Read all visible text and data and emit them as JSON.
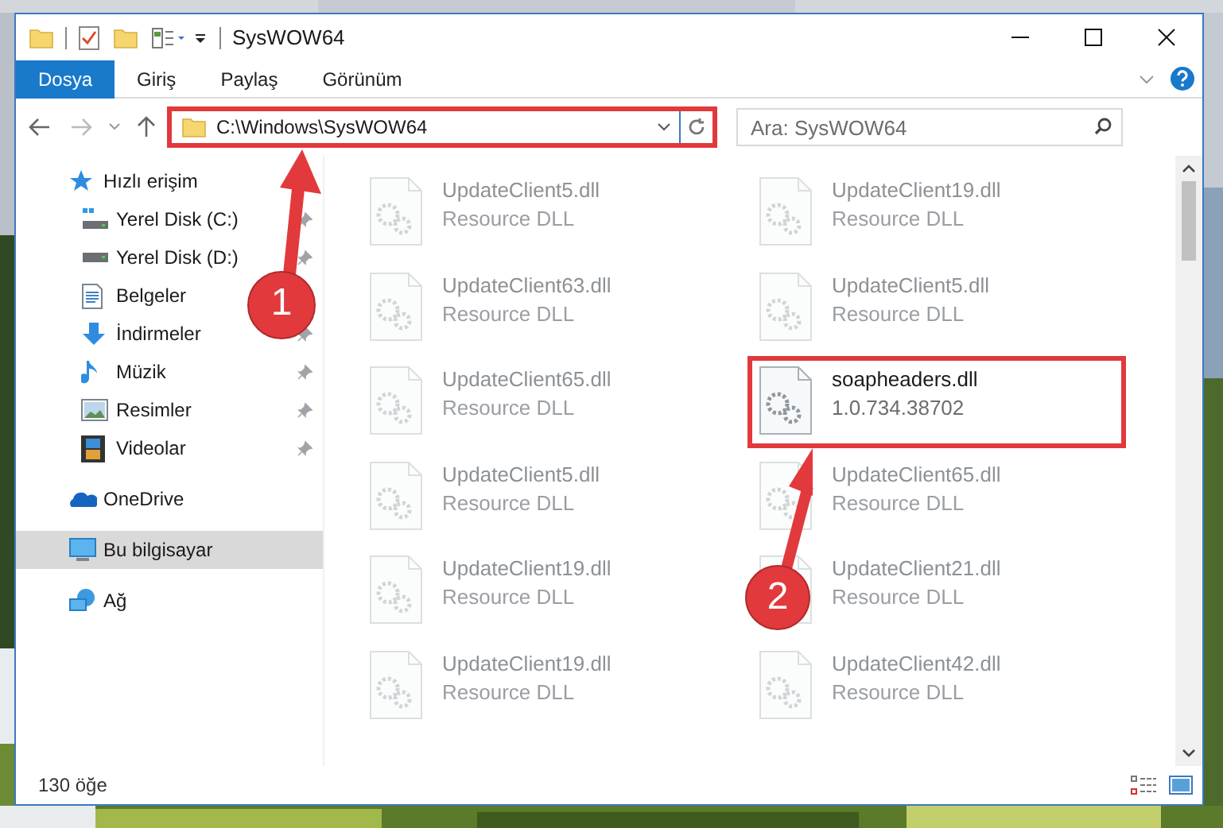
{
  "window": {
    "title": "SysWOW64"
  },
  "ribbon": {
    "tabs": [
      {
        "label": "Dosya",
        "kind": "file"
      },
      {
        "label": "Giriş",
        "kind": "tab"
      },
      {
        "label": "Paylaş",
        "kind": "tab"
      },
      {
        "label": "Görünüm",
        "kind": "tab"
      }
    ]
  },
  "address_bar": {
    "path": "C:\\Windows\\SysWOW64",
    "marked": true
  },
  "search": {
    "placeholder": "Ara: SysWOW64"
  },
  "sidebar": {
    "items": [
      {
        "label": "Hızlı erişim",
        "kind": "star",
        "selected": false,
        "children": [
          {
            "label": "Yerel Disk (C:)",
            "kind": "drive-windows",
            "pinned": true
          },
          {
            "label": "Yerel Disk (D:)",
            "kind": "drive",
            "pinned": true
          },
          {
            "label": "Belgeler",
            "kind": "documents"
          },
          {
            "label": "İndirmeler",
            "kind": "downloads",
            "pinned": true
          },
          {
            "label": "Müzik",
            "kind": "music",
            "pinned": true
          },
          {
            "label": "Resimler",
            "kind": "pictures",
            "pinned": true
          },
          {
            "label": "Videolar",
            "kind": "videos",
            "pinned": true
          }
        ]
      },
      {
        "label": "OneDrive",
        "kind": "cloud",
        "selected": false
      },
      {
        "label": "Bu bilgisayar",
        "kind": "computer",
        "selected": true
      },
      {
        "label": "Ağ",
        "kind": "network",
        "selected": false
      }
    ]
  },
  "files": [
    {
      "name": "UpdateClient5.dll",
      "detail": "Resource DLL",
      "faded": true,
      "marked": false
    },
    {
      "name": "UpdateClient19.dll",
      "detail": "Resource DLL",
      "faded": true,
      "marked": false
    },
    {
      "name": "UpdateClient63.dll",
      "detail": "Resource DLL",
      "faded": true,
      "marked": false
    },
    {
      "name": "UpdateClient5.dll",
      "detail": "Resource DLL",
      "faded": true,
      "marked": false
    },
    {
      "name": "UpdateClient65.dll",
      "detail": "Resource DLL",
      "faded": true,
      "marked": false
    },
    {
      "name": "soapheaders.dll",
      "detail": "1.0.734.38702",
      "faded": false,
      "marked": true
    },
    {
      "name": "UpdateClient5.dll",
      "detail": "Resource DLL",
      "faded": true,
      "marked": false
    },
    {
      "name": "UpdateClient65.dll",
      "detail": "Resource DLL",
      "faded": true,
      "marked": false
    },
    {
      "name": "UpdateClient19.dll",
      "detail": "Resource DLL",
      "faded": true,
      "marked": false
    },
    {
      "name": "UpdateClient21.dll",
      "detail": "Resource DLL",
      "faded": true,
      "marked": false
    },
    {
      "name": "UpdateClient19.dll",
      "detail": "Resource DLL",
      "faded": true,
      "marked": false
    },
    {
      "name": "UpdateClient42.dll",
      "detail": "Resource DLL",
      "faded": true,
      "marked": false
    }
  ],
  "status_bar": {
    "count": "130 öğe"
  },
  "annotations": [
    {
      "number": "1"
    },
    {
      "number": "2"
    }
  ]
}
